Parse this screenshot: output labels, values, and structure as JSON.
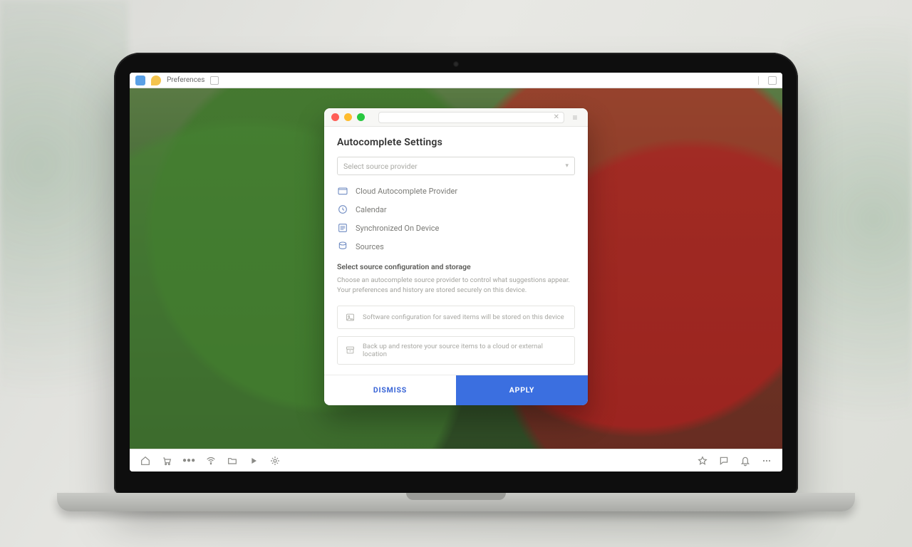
{
  "os_bar": {
    "app_label": "Preferences",
    "tray_icon": "menu"
  },
  "dialog": {
    "title": "Autocomplete Settings",
    "select_placeholder": "Select source provider",
    "options": [
      {
        "icon": "folder-icon",
        "label": "Cloud autocomplete provider"
      },
      {
        "icon": "clock-icon",
        "label": "Calendar"
      },
      {
        "icon": "list-icon",
        "label": "Synchronized on device"
      },
      {
        "icon": "database-icon",
        "label": "Sources"
      }
    ],
    "section": {
      "heading": "Select source configuration and storage",
      "description": "Choose an autocomplete source provider to control what suggestions appear. Your preferences and history are stored securely on this device."
    },
    "rows": [
      {
        "icon": "image-icon",
        "label": "Software configuration for saved items will be stored on this device"
      },
      {
        "icon": "archive-icon",
        "label": "Back up and restore your source items to a cloud or external location"
      }
    ],
    "buttons": {
      "secondary": "DISMISS",
      "primary": "APPLY"
    }
  },
  "taskbar": {
    "items": [
      "home",
      "cart",
      "network",
      "wifi",
      "folder",
      "play",
      "settings"
    ],
    "tray": [
      "star",
      "chat",
      "bell",
      "more"
    ]
  }
}
